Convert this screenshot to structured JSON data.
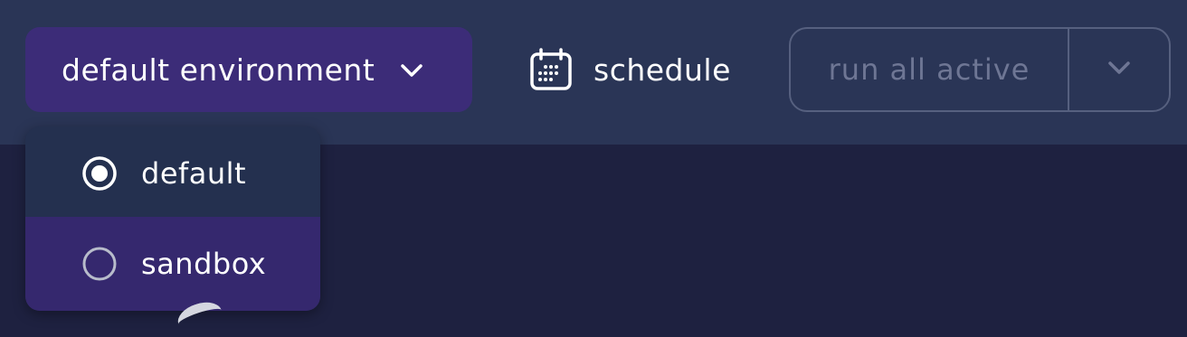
{
  "toolbar": {
    "environment_selector": {
      "label": "default environment",
      "icon": "chevron-down-icon"
    },
    "schedule": {
      "label": "schedule",
      "icon": "calendar-icon"
    },
    "run": {
      "label": "run all active",
      "toggle_icon": "chevron-down-icon"
    }
  },
  "environment_menu": {
    "options": [
      {
        "label": "default",
        "selected": true
      },
      {
        "label": "sandbox",
        "selected": false
      }
    ]
  },
  "colors": {
    "topbar": "#2a3556",
    "background": "#1e2140",
    "accent": "#3c2c78",
    "menu_highlight": "#35286e",
    "disabled_text": "#6e7694"
  }
}
